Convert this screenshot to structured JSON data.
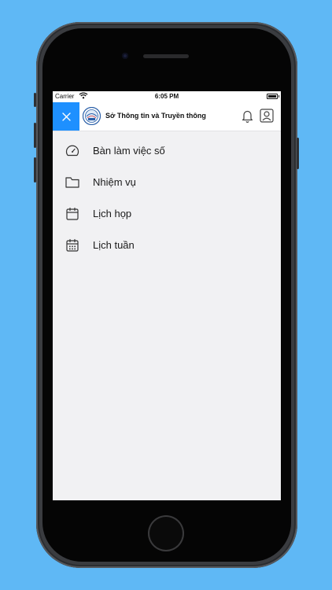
{
  "statusbar": {
    "carrier": "Carrier",
    "time": "6:05 PM",
    "wifi_icon": "wifi-icon",
    "battery_icon": "battery-icon"
  },
  "header": {
    "title": "Sở Thông tin và Truyền thông",
    "close_icon": "close-icon",
    "logo": "organization-logo",
    "notification_icon": "bell-icon",
    "profile_icon": "user-profile-icon",
    "accent_color": "#1e90ff"
  },
  "menu": {
    "items": [
      {
        "label": "Bàn làm việc số",
        "icon": "gauge-icon"
      },
      {
        "label": "Nhiệm vụ",
        "icon": "folder-icon"
      },
      {
        "label": "Lịch họp",
        "icon": "calendar-icon"
      },
      {
        "label": "Lịch tuần",
        "icon": "calendar-week-icon"
      }
    ]
  },
  "colors": {
    "page_background": "#5fb8f5",
    "screen_background": "#f1f1f3",
    "header_background": "#ffffff"
  }
}
